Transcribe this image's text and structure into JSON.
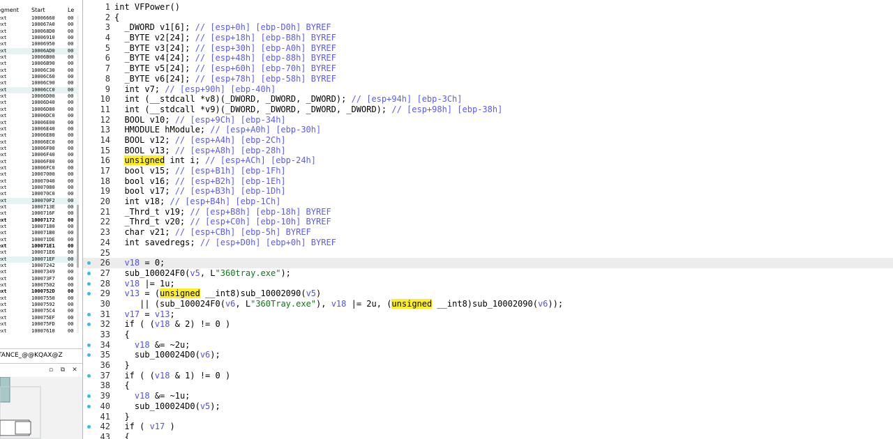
{
  "segments_panel": {
    "headers": {
      "segment": "egment",
      "start": "Start",
      "len": "Le"
    },
    "rows": [
      {
        "seg": "ext",
        "start": "10006660",
        "len": "00",
        "alt": false,
        "bold": false
      },
      {
        "seg": "ext",
        "start": "100067A0",
        "len": "00",
        "alt": false,
        "bold": false
      },
      {
        "seg": "ext",
        "start": "100068D0",
        "len": "00",
        "alt": false,
        "bold": false
      },
      {
        "seg": "ext",
        "start": "10006910",
        "len": "00",
        "alt": false,
        "bold": false
      },
      {
        "seg": "ext",
        "start": "10006950",
        "len": "00",
        "alt": false,
        "bold": false
      },
      {
        "seg": "ext",
        "start": "10006AD0",
        "len": "00",
        "alt": true,
        "bold": false
      },
      {
        "seg": "ext",
        "start": "10006B00",
        "len": "00",
        "alt": false,
        "bold": false
      },
      {
        "seg": "ext",
        "start": "10006B90",
        "len": "00",
        "alt": false,
        "bold": false
      },
      {
        "seg": "ext",
        "start": "10006C30",
        "len": "00",
        "alt": false,
        "bold": false
      },
      {
        "seg": "ext",
        "start": "10006C60",
        "len": "00",
        "alt": false,
        "bold": false
      },
      {
        "seg": "ext",
        "start": "10006C90",
        "len": "00",
        "alt": false,
        "bold": false
      },
      {
        "seg": "ext",
        "start": "10006CC0",
        "len": "00",
        "alt": true,
        "bold": false
      },
      {
        "seg": "ext",
        "start": "10006D00",
        "len": "00",
        "alt": false,
        "bold": false
      },
      {
        "seg": "ext",
        "start": "10006D40",
        "len": "00",
        "alt": false,
        "bold": false
      },
      {
        "seg": "ext",
        "start": "10006D80",
        "len": "00",
        "alt": false,
        "bold": false
      },
      {
        "seg": "ext",
        "start": "10006DC0",
        "len": "00",
        "alt": false,
        "bold": false
      },
      {
        "seg": "ext",
        "start": "10006E00",
        "len": "00",
        "alt": false,
        "bold": false
      },
      {
        "seg": "ext",
        "start": "10006E40",
        "len": "00",
        "alt": false,
        "bold": false
      },
      {
        "seg": "ext",
        "start": "10006E80",
        "len": "00",
        "alt": false,
        "bold": false
      },
      {
        "seg": "ext",
        "start": "10006EC0",
        "len": "00",
        "alt": false,
        "bold": false
      },
      {
        "seg": "ext",
        "start": "10006F00",
        "len": "00",
        "alt": false,
        "bold": false
      },
      {
        "seg": "ext",
        "start": "10006F40",
        "len": "00",
        "alt": false,
        "bold": false
      },
      {
        "seg": "ext",
        "start": "10006F80",
        "len": "00",
        "alt": false,
        "bold": false
      },
      {
        "seg": "ext",
        "start": "10006FC0",
        "len": "00",
        "alt": false,
        "bold": false
      },
      {
        "seg": "ext",
        "start": "10007000",
        "len": "00",
        "alt": false,
        "bold": false
      },
      {
        "seg": "ext",
        "start": "10007040",
        "len": "00",
        "alt": false,
        "bold": false
      },
      {
        "seg": "ext",
        "start": "10007080",
        "len": "00",
        "alt": false,
        "bold": false
      },
      {
        "seg": "ext",
        "start": "100070C0",
        "len": "00",
        "alt": false,
        "bold": false
      },
      {
        "seg": "ext",
        "start": "100070F2",
        "len": "00",
        "alt": true,
        "bold": false
      },
      {
        "seg": "ext",
        "start": "1000713E",
        "len": "00",
        "alt": false,
        "bold": false
      },
      {
        "seg": "ext",
        "start": "1000716F",
        "len": "00",
        "alt": false,
        "bold": false
      },
      {
        "seg": "ext",
        "start": "10007172",
        "len": "00",
        "alt": false,
        "bold": true
      },
      {
        "seg": "ext",
        "start": "10007180",
        "len": "00",
        "alt": false,
        "bold": false
      },
      {
        "seg": "ext",
        "start": "100071B0",
        "len": "00",
        "alt": false,
        "bold": false
      },
      {
        "seg": "ext",
        "start": "100071DE",
        "len": "00",
        "alt": false,
        "bold": false
      },
      {
        "seg": "ext",
        "start": "100071E1",
        "len": "00",
        "alt": false,
        "bold": true
      },
      {
        "seg": "ext",
        "start": "100071E6",
        "len": "00",
        "alt": false,
        "bold": false
      },
      {
        "seg": "ext",
        "start": "100071EF",
        "len": "00",
        "alt": true,
        "bold": false
      },
      {
        "seg": "ext",
        "start": "10007242",
        "len": "00",
        "alt": false,
        "bold": false
      },
      {
        "seg": "ext",
        "start": "10007349",
        "len": "00",
        "alt": false,
        "bold": false
      },
      {
        "seg": "ext",
        "start": "100073F7",
        "len": "00",
        "alt": false,
        "bold": false
      },
      {
        "seg": "ext",
        "start": "10007502",
        "len": "00",
        "alt": false,
        "bold": false
      },
      {
        "seg": "ext",
        "start": "1000752D",
        "len": "00",
        "alt": false,
        "bold": true
      },
      {
        "seg": "ext",
        "start": "10007550",
        "len": "00",
        "alt": false,
        "bold": false
      },
      {
        "seg": "ext",
        "start": "10007592",
        "len": "00",
        "alt": false,
        "bold": false
      },
      {
        "seg": "ext",
        "start": "100075C4",
        "len": "00",
        "alt": false,
        "bold": false
      },
      {
        "seg": "ext",
        "start": "100075EF",
        "len": "00",
        "alt": false,
        "bold": false
      },
      {
        "seg": "ext",
        "start": "100075FD",
        "len": "00",
        "alt": false,
        "bold": false
      },
      {
        "seg": "ext",
        "start": "10007610",
        "len": "00",
        "alt": false,
        "bold": false
      }
    ]
  },
  "name_bar": {
    "text": "TANCE_@@KQAX@Z"
  },
  "overview_bar": {
    "restore_label": "▫",
    "float_label": "⧉",
    "close_label": "✕"
  },
  "code": {
    "current_line": 26,
    "lines": [
      {
        "n": "1",
        "bp": false,
        "tokens": [
          [
            "t",
            "int VFPower()"
          ]
        ]
      },
      {
        "n": "2",
        "bp": false,
        "tokens": [
          [
            "t",
            "{"
          ]
        ]
      },
      {
        "n": "3",
        "bp": false,
        "tokens": [
          [
            "t",
            "  _DWORD v1[6]; "
          ],
          [
            "c",
            "// [esp+0h] [ebp-D0h] BYREF"
          ]
        ]
      },
      {
        "n": "4",
        "bp": false,
        "tokens": [
          [
            "t",
            "  _BYTE v2[24]; "
          ],
          [
            "c",
            "// [esp+18h] [ebp-B8h] BYREF"
          ]
        ]
      },
      {
        "n": "5",
        "bp": false,
        "tokens": [
          [
            "t",
            "  _BYTE v3[24]; "
          ],
          [
            "c",
            "// [esp+30h] [ebp-A0h] BYREF"
          ]
        ]
      },
      {
        "n": "6",
        "bp": false,
        "tokens": [
          [
            "t",
            "  _BYTE v4[24]; "
          ],
          [
            "c",
            "// [esp+48h] [ebp-88h] BYREF"
          ]
        ]
      },
      {
        "n": "7",
        "bp": false,
        "tokens": [
          [
            "t",
            "  _BYTE v5[24]; "
          ],
          [
            "c",
            "// [esp+60h] [ebp-70h] BYREF"
          ]
        ]
      },
      {
        "n": "8",
        "bp": false,
        "tokens": [
          [
            "t",
            "  _BYTE v6[24]; "
          ],
          [
            "c",
            "// [esp+78h] [ebp-58h] BYREF"
          ]
        ]
      },
      {
        "n": "9",
        "bp": false,
        "tokens": [
          [
            "t",
            "  int v7; "
          ],
          [
            "c",
            "// [esp+90h] [ebp-40h]"
          ]
        ]
      },
      {
        "n": "10",
        "bp": false,
        "tokens": [
          [
            "t",
            "  int (__stdcall *v8)(_DWORD, _DWORD, _DWORD); "
          ],
          [
            "c",
            "// [esp+94h] [ebp-3Ch]"
          ]
        ]
      },
      {
        "n": "11",
        "bp": false,
        "tokens": [
          [
            "t",
            "  int (__stdcall *v9)(_DWORD, _DWORD, _DWORD, _DWORD); "
          ],
          [
            "c",
            "// [esp+98h] [ebp-38h]"
          ]
        ]
      },
      {
        "n": "12",
        "bp": false,
        "tokens": [
          [
            "k",
            "  BOOL v10; "
          ],
          [
            "c",
            "// [esp+9Ch] [ebp-34h]"
          ]
        ]
      },
      {
        "n": "13",
        "bp": false,
        "tokens": [
          [
            "k",
            "  HMODULE hModule; "
          ],
          [
            "c",
            "// [esp+A0h] [ebp-30h]"
          ]
        ]
      },
      {
        "n": "14",
        "bp": false,
        "tokens": [
          [
            "k",
            "  BOOL v12; "
          ],
          [
            "c",
            "// [esp+A4h] [ebp-2Ch]"
          ]
        ]
      },
      {
        "n": "15",
        "bp": false,
        "tokens": [
          [
            "k",
            "  BOOL v13; "
          ],
          [
            "c",
            "// [esp+A8h] [ebp-28h]"
          ]
        ]
      },
      {
        "n": "16",
        "bp": false,
        "tokens": [
          [
            "t",
            "  "
          ],
          [
            "h",
            "unsigned"
          ],
          [
            "k",
            " int i; "
          ],
          [
            "c",
            "// [esp+ACh] [ebp-24h]"
          ]
        ]
      },
      {
        "n": "17",
        "bp": false,
        "tokens": [
          [
            "k",
            "  bool v15; "
          ],
          [
            "c",
            "// [esp+B1h] [ebp-1Fh]"
          ]
        ]
      },
      {
        "n": "18",
        "bp": false,
        "tokens": [
          [
            "k",
            "  bool v16; "
          ],
          [
            "c",
            "// [esp+B2h] [ebp-1Eh]"
          ]
        ]
      },
      {
        "n": "19",
        "bp": false,
        "tokens": [
          [
            "k",
            "  bool v17; "
          ],
          [
            "c",
            "// [esp+B3h] [ebp-1Dh]"
          ]
        ]
      },
      {
        "n": "20",
        "bp": false,
        "tokens": [
          [
            "t",
            "  int v18; "
          ],
          [
            "c",
            "// [esp+B4h] [ebp-1Ch]"
          ]
        ]
      },
      {
        "n": "21",
        "bp": false,
        "tokens": [
          [
            "t",
            "  _Thrd_t v19; "
          ],
          [
            "c",
            "// [esp+B8h] [ebp-18h] BYREF"
          ]
        ]
      },
      {
        "n": "22",
        "bp": false,
        "tokens": [
          [
            "k",
            "  _Thrd_t v20; "
          ],
          [
            "c",
            "// [esp+C0h] [ebp-10h] BYREF"
          ]
        ]
      },
      {
        "n": "23",
        "bp": false,
        "tokens": [
          [
            "t",
            "  char v21; "
          ],
          [
            "c",
            "// [esp+CBh] [ebp-5h] BYREF"
          ]
        ]
      },
      {
        "n": "24",
        "bp": false,
        "tokens": [
          [
            "t",
            "  int savedregs; "
          ],
          [
            "c",
            "// [esp+D0h] [ebp+0h] BYREF"
          ]
        ]
      },
      {
        "n": "25",
        "bp": false,
        "tokens": [
          [
            "t",
            ""
          ]
        ]
      },
      {
        "n": "26",
        "bp": true,
        "tokens": [
          [
            "t",
            "  "
          ],
          [
            "v",
            "v18"
          ],
          [
            "k",
            " = 0;"
          ]
        ]
      },
      {
        "n": "27",
        "bp": true,
        "tokens": [
          [
            "k",
            "  sub_100024F0("
          ],
          [
            "v",
            "v5"
          ],
          [
            "k",
            ", L"
          ],
          [
            "s",
            "\"360tray.exe\""
          ],
          [
            "k",
            ");"
          ]
        ]
      },
      {
        "n": "28",
        "bp": true,
        "tokens": [
          [
            "t",
            "  "
          ],
          [
            "v",
            "v18"
          ],
          [
            "k",
            " |= 1u;"
          ]
        ]
      },
      {
        "n": "29",
        "bp": true,
        "tokens": [
          [
            "t",
            "  "
          ],
          [
            "v",
            "v13"
          ],
          [
            "k",
            " = ("
          ],
          [
            "h",
            "unsigned"
          ],
          [
            "k",
            " __int8)sub_10002090("
          ],
          [
            "v",
            "v5"
          ],
          [
            "k",
            ")"
          ]
        ]
      },
      {
        "n": "30",
        "bp": false,
        "tokens": [
          [
            "k",
            "     || (sub_100024F0("
          ],
          [
            "v",
            "v6"
          ],
          [
            "k",
            ", L"
          ],
          [
            "s",
            "\"360Tray.exe\""
          ],
          [
            "k",
            "), "
          ],
          [
            "v",
            "v18"
          ],
          [
            "k",
            " |= 2u, ("
          ],
          [
            "h",
            "unsigned"
          ],
          [
            "k",
            " __int8)sub_10002090("
          ],
          [
            "v",
            "v6"
          ],
          [
            "k",
            "));"
          ]
        ]
      },
      {
        "n": "31",
        "bp": true,
        "tokens": [
          [
            "t",
            "  "
          ],
          [
            "v",
            "v17"
          ],
          [
            "k",
            " = "
          ],
          [
            "v",
            "v13"
          ],
          [
            "k",
            ";"
          ]
        ]
      },
      {
        "n": "32",
        "bp": true,
        "tokens": [
          [
            "k",
            "  if ( ("
          ],
          [
            "v",
            "v18"
          ],
          [
            "k",
            " & 2) != 0 )"
          ]
        ]
      },
      {
        "n": "33",
        "bp": false,
        "tokens": [
          [
            "k",
            "  {"
          ]
        ]
      },
      {
        "n": "34",
        "bp": true,
        "tokens": [
          [
            "t",
            "    "
          ],
          [
            "v",
            "v18"
          ],
          [
            "k",
            " &= ~2u;"
          ]
        ]
      },
      {
        "n": "35",
        "bp": true,
        "tokens": [
          [
            "k",
            "    sub_100024D0("
          ],
          [
            "v",
            "v6"
          ],
          [
            "k",
            ");"
          ]
        ]
      },
      {
        "n": "36",
        "bp": false,
        "tokens": [
          [
            "k",
            "  }"
          ]
        ]
      },
      {
        "n": "37",
        "bp": true,
        "tokens": [
          [
            "k",
            "  if ( ("
          ],
          [
            "v",
            "v18"
          ],
          [
            "k",
            " & 1) != 0 )"
          ]
        ]
      },
      {
        "n": "38",
        "bp": false,
        "tokens": [
          [
            "k",
            "  {"
          ]
        ]
      },
      {
        "n": "39",
        "bp": true,
        "tokens": [
          [
            "t",
            "    "
          ],
          [
            "v",
            "v18"
          ],
          [
            "k",
            " &= ~1u;"
          ]
        ]
      },
      {
        "n": "40",
        "bp": true,
        "tokens": [
          [
            "k",
            "    sub_100024D0("
          ],
          [
            "v",
            "v5"
          ],
          [
            "k",
            ");"
          ]
        ]
      },
      {
        "n": "41",
        "bp": false,
        "tokens": [
          [
            "k",
            "  }"
          ]
        ]
      },
      {
        "n": "42",
        "bp": true,
        "tokens": [
          [
            "k",
            "  if ( "
          ],
          [
            "v",
            "v17"
          ],
          [
            "k",
            " )"
          ]
        ]
      },
      {
        "n": "43",
        "bp": false,
        "tokens": [
          [
            "k",
            "  {"
          ]
        ]
      }
    ]
  },
  "colors": {
    "comment": "#5a5aff",
    "variable": "#5050ee",
    "string": "#0a7a16",
    "highlight": "#ffee20",
    "breakpoint_dot": "#30bfe8",
    "current_line_bg": "#ececec",
    "segment_alt_row": "#e6f3f3"
  }
}
